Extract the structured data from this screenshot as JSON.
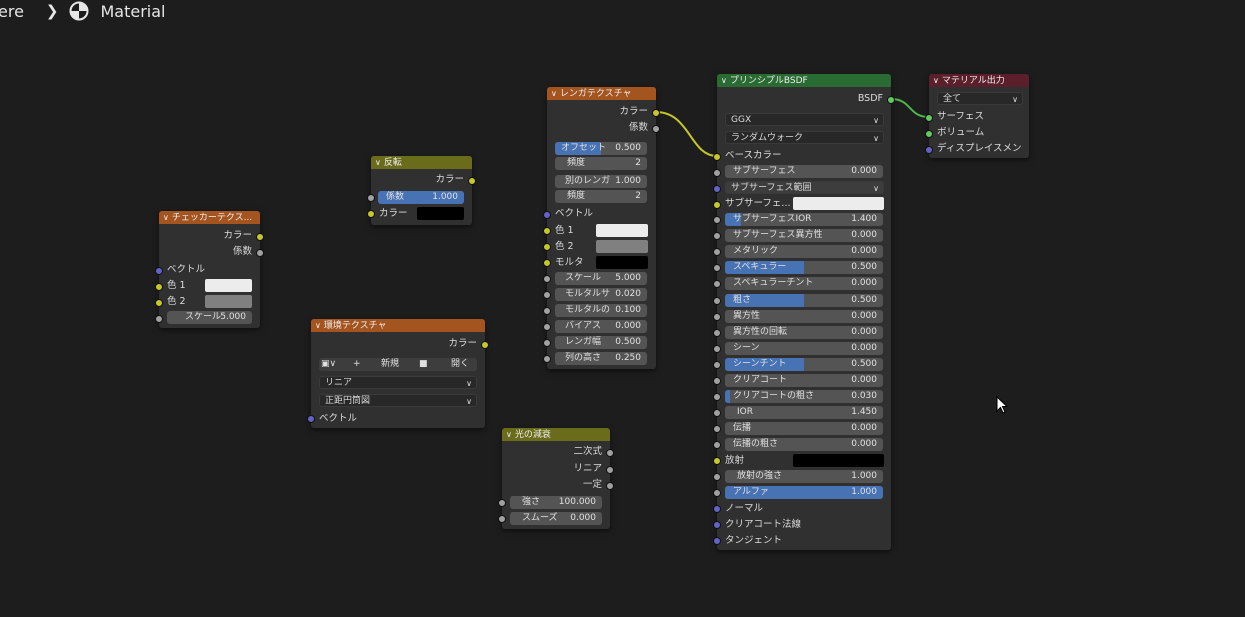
{
  "breadcrumb": {
    "prev": "ere",
    "current": "Material"
  },
  "colors": {
    "socket_color": "#c7c729",
    "socket_float": "#a1a1a1",
    "socket_vector": "#6363c7",
    "socket_shader": "#63c763",
    "field_fill": "#4772b3"
  },
  "checker": {
    "title": "チェッカーテクス...",
    "out_color": "カラー",
    "out_fac": "係数",
    "in_vector": "ベクトル",
    "color1": "色 1",
    "color2": "色 2",
    "scale_label": "スケール",
    "scale_value": "5.000"
  },
  "invert": {
    "title": "反転",
    "out_color": "カラー",
    "fac_label": "係数",
    "fac_value": "1.000",
    "in_color": "カラー"
  },
  "envtex": {
    "title": "環境テクスチャ",
    "out_color": "カラー",
    "new_label": "新規",
    "open_label": "開く",
    "interp": "リニア",
    "projection": "正距円筒図",
    "in_vector": "ベクトル"
  },
  "brick": {
    "title": "レンガテクスチャ",
    "out_color": "カラー",
    "out_fac": "係数",
    "offset_label": "オフセット",
    "offset_value": "0.500",
    "offset_fill": 0.5,
    "freq1_label": "頻度",
    "freq1_value": "2",
    "squash_label": "別のレンガ",
    "squash_value": "1.000",
    "freq2_label": "頻度",
    "freq2_value": "2",
    "in_vector": "ベクトル",
    "color1": "色 1",
    "color2": "色 2",
    "mortar": "モルタ",
    "scale_label": "スケール",
    "scale_value": "5.000",
    "mortar_size_label": "モルタルサ",
    "mortar_size_value": "0.020",
    "mortar_smooth_label": "モルタルの",
    "mortar_smooth_value": "0.100",
    "bias_label": "バイアス",
    "bias_value": "0.000",
    "brick_width_label": "レンガ幅",
    "brick_width_value": "0.500",
    "row_height_label": "列の高さ",
    "row_height_value": "0.250"
  },
  "falloff": {
    "title": "光の減衰",
    "out_quadratic": "二次式",
    "out_linear": "リニア",
    "out_constant": "一定",
    "strength_label": "強さ",
    "strength_value": "100.000",
    "smooth_label": "スムーズ",
    "smooth_value": "0.000"
  },
  "bsdf": {
    "title": "プリンシプルBSDF",
    "out_bsdf": "BSDF",
    "distribution": "GGX",
    "subsurface_method": "ランダムウォーク",
    "base_color": "ベースカラー",
    "subsurface_label": "サブサーフェス",
    "subsurface_value": "0.000",
    "subsurface_radius": "サブサーフェス範囲",
    "subsurface_color": "サブサーフェ...",
    "params": [
      {
        "label": "サブサーフェスIOR",
        "value": "1.400",
        "fill": 0.1
      },
      {
        "label": "サブサーフェス異方性",
        "value": "0.000",
        "fill": 0
      },
      {
        "label": "メタリック",
        "value": "0.000",
        "fill": 0
      },
      {
        "label": "スペキュラー",
        "value": "0.500",
        "fill": 0.5
      },
      {
        "label": "スペキュラーチント",
        "value": "0.000",
        "fill": 0
      },
      {
        "label": "粗さ",
        "value": "0.500",
        "fill": 0.5
      },
      {
        "label": "異方性",
        "value": "0.000",
        "fill": 0
      },
      {
        "label": "異方性の回転",
        "value": "0.000",
        "fill": 0
      },
      {
        "label": "シーン",
        "value": "0.000",
        "fill": 0
      },
      {
        "label": "シーンチント",
        "value": "0.500",
        "fill": 0.5
      },
      {
        "label": "クリアコート",
        "value": "0.000",
        "fill": 0
      },
      {
        "label": "クリアコートの粗さ",
        "value": "0.030",
        "fill": 0.03
      },
      {
        "label": "IOR",
        "value": "1.450",
        "fill": 0
      },
      {
        "label": "伝播",
        "value": "0.000",
        "fill": 0
      },
      {
        "label": "伝播の粗さ",
        "value": "0.000",
        "fill": 0
      }
    ],
    "emission": "放射",
    "emission_strength_label": "放射の強さ",
    "emission_strength_value": "1.000",
    "alpha_label": "アルファ",
    "alpha_value": "1.000",
    "normal": "ノーマル",
    "clearcoat_normal": "クリアコート法線",
    "tangent": "タンジェント"
  },
  "output": {
    "title": "マテリアル出力",
    "target": "全て",
    "surface": "サーフェス",
    "volume": "ボリューム",
    "displacement": "ディスプレイスメン"
  }
}
